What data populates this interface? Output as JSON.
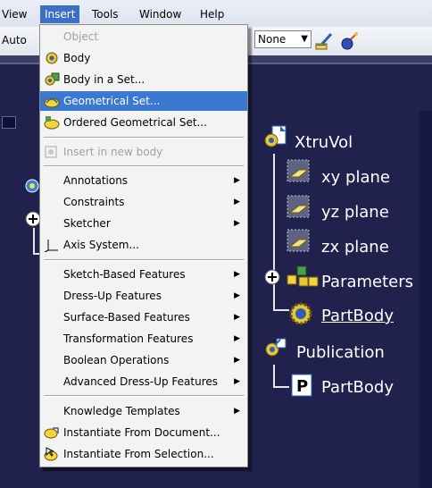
{
  "menubar": {
    "items": [
      {
        "label": "View"
      },
      {
        "label": "Insert"
      },
      {
        "label": "Tools"
      },
      {
        "label": "Window"
      },
      {
        "label": "Help"
      }
    ]
  },
  "toolbar": {
    "auto_label": "Auto",
    "select_value": "None",
    "icons": [
      "paint-brush-icon",
      "magic-wand-icon"
    ]
  },
  "insert_menu": {
    "items": [
      {
        "label": "Object",
        "disabled": true
      },
      {
        "label": "Body",
        "icon": "body-icon"
      },
      {
        "label": "Body in a Set...",
        "icon": "body-in-set-icon"
      },
      {
        "label": "Geometrical Set...",
        "icon": "geometrical-set-icon",
        "highlighted": true
      },
      {
        "label": "Ordered Geometrical Set...",
        "icon": "ordered-geometrical-set-icon"
      },
      {
        "label": "Insert in new body",
        "disabled": true,
        "icon": "insert-in-new-body-icon"
      },
      {
        "label": "Annotations",
        "submenu": true
      },
      {
        "label": "Constraints",
        "submenu": true
      },
      {
        "label": "Sketcher",
        "submenu": true
      },
      {
        "label": "Axis System...",
        "icon": "axis-system-icon"
      },
      {
        "label": "Sketch-Based Features",
        "submenu": true
      },
      {
        "label": "Dress-Up Features",
        "submenu": true
      },
      {
        "label": "Surface-Based Features",
        "submenu": true
      },
      {
        "label": "Transformation Features",
        "submenu": true
      },
      {
        "label": "Boolean Operations",
        "submenu": true
      },
      {
        "label": "Advanced Dress-Up Features",
        "submenu": true
      },
      {
        "label": "Knowledge Templates",
        "submenu": true
      },
      {
        "label": "Instantiate From Document...",
        "icon": "instantiate-document-icon"
      },
      {
        "label": "Instantiate From Selection...",
        "icon": "instantiate-selection-icon"
      }
    ]
  },
  "tree": {
    "root": "XtruVol",
    "planes": [
      "xy plane",
      "yz plane",
      "zx plane"
    ],
    "parameters": "Parameters",
    "part_body": "PartBody",
    "publication": "Publication",
    "publication_child": "PartBody"
  },
  "colors": {
    "workspace": "#20214d",
    "highlight": "#3a78d2",
    "menubar_active": "#3b70c6"
  }
}
